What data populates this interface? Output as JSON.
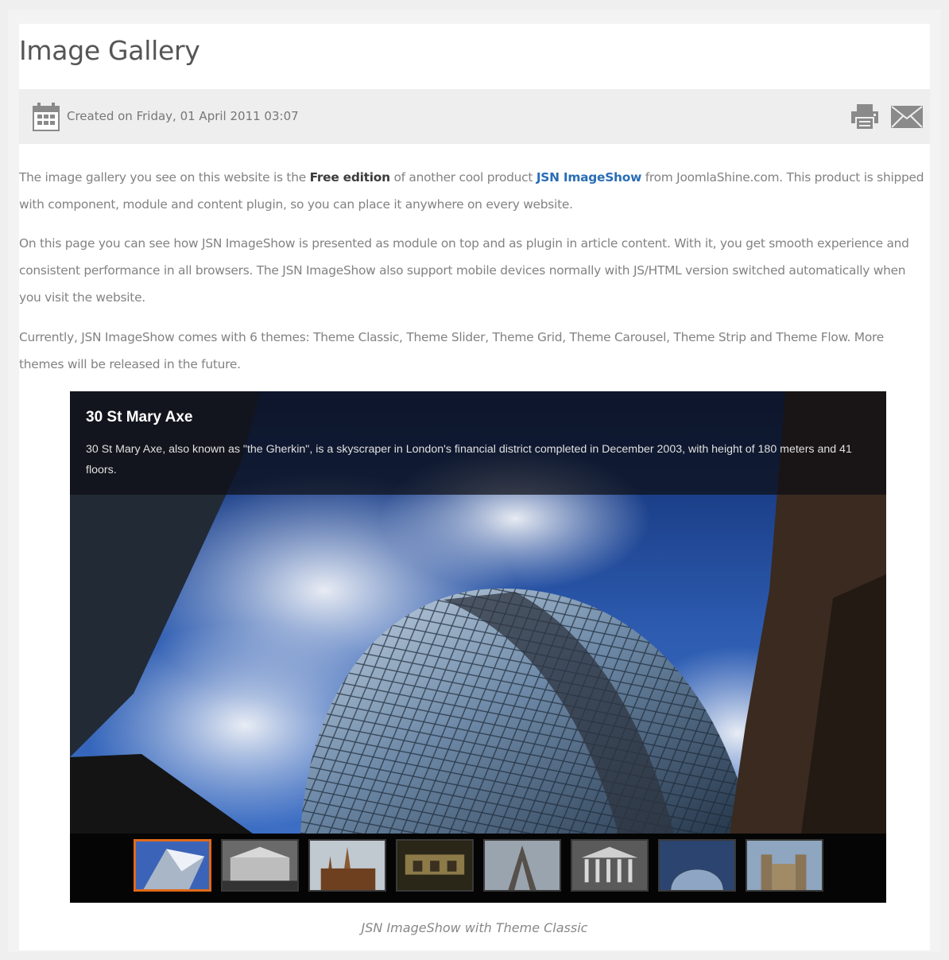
{
  "article": {
    "title": "Image Gallery",
    "meta": {
      "created": "Created on Friday, 01 April 2011 03:07",
      "print_icon": "print-icon",
      "email_icon": "email-icon"
    },
    "paragraphs": {
      "p1_a": "The image gallery you see on this website is the ",
      "p1_bold": "Free edition",
      "p1_b": " of another cool product ",
      "p1_link": "JSN ImageShow",
      "p1_c": " from JoomlaShine.com. This product is shipped with component, module and content plugin, so you can place it anywhere on every website.",
      "p2": "On this page you can see how JSN ImageShow is presented as module on top and as plugin in article content. With it, you get smooth experience and consistent performance in all browsers. The JSN ImageShow also support mobile devices normally with JS/HTML version switched automatically when you visit the website.",
      "p3": "Currently, JSN ImageShow comes with 6 themes: Theme Classic, Theme Slider, Theme Grid, Theme Carousel, Theme Strip and Theme Flow. More themes will be released in the future."
    }
  },
  "gallery": {
    "caption_title": "30 St Mary Axe",
    "caption_desc": "30 St Mary Axe, also known as \"the Gherkin\", is a skyscraper  in London's financial district completed in December 2003, with height of 180 meters and 41 floors.",
    "active_thumb_color": "#e06a1a",
    "thumb_count": 8,
    "active_thumb_index": 0
  },
  "caption": "JSN ImageShow with Theme Classic",
  "colors": {
    "link": "#2a6db5",
    "body_text": "#828282",
    "meta_bar": "#eeeeee"
  }
}
